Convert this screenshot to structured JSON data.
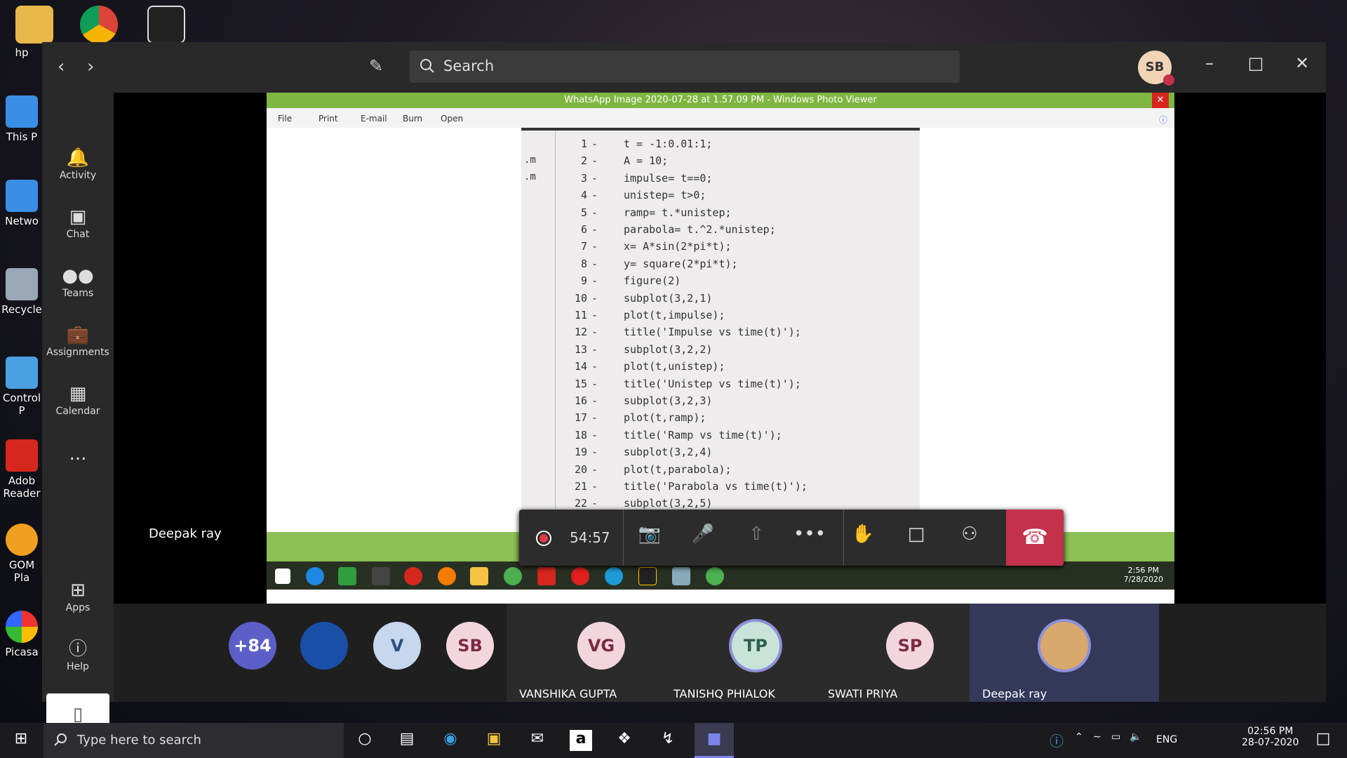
{
  "desktop": {
    "icons": [
      {
        "label": "hp"
      },
      {
        "label": "This P"
      },
      {
        "label": "Netwo"
      },
      {
        "label": "Recycle"
      },
      {
        "label": "Control P"
      },
      {
        "label": "Adob Reader"
      },
      {
        "label": "GOM Pla"
      },
      {
        "label": "Picasa"
      }
    ]
  },
  "teams": {
    "search_placeholder": "Search",
    "user_initials": "SB",
    "rail": [
      {
        "label": "Activity",
        "icon": "bell-icon"
      },
      {
        "label": "Chat",
        "icon": "chat-icon"
      },
      {
        "label": "Teams",
        "icon": "teams-icon"
      },
      {
        "label": "Assignments",
        "icon": "assignments-icon"
      },
      {
        "label": "Calendar",
        "icon": "calendar-icon"
      },
      {
        "label": "...",
        "icon": "more-icon"
      },
      {
        "label": "Apps",
        "icon": "apps-icon"
      },
      {
        "label": "Help",
        "icon": "help-icon"
      }
    ],
    "presenter_label": "Deepak ray",
    "call_timer": "54:57",
    "accent": "#c4314b"
  },
  "viewer": {
    "title": "WhatsApp Image 2020-07-28 at 1.57.09 PM - Windows Photo Viewer",
    "menu": [
      "File",
      "Print",
      "E-mail",
      "Burn",
      "Open"
    ],
    "side_labels": [
      ".m",
      ".m"
    ],
    "code_lines": [
      {
        "n": "1",
        "code": "t = -1:0.01:1;"
      },
      {
        "n": "2",
        "code": "A = 10;"
      },
      {
        "n": "3",
        "code": "impulse= t==0;"
      },
      {
        "n": "4",
        "code": "unistep= t>0;"
      },
      {
        "n": "5",
        "code": "ramp= t.*unistep;"
      },
      {
        "n": "6",
        "code": "parabola= t.^2.*unistep;"
      },
      {
        "n": "7",
        "code": "x= A*sin(2*pi*t);"
      },
      {
        "n": "8",
        "code": "y= square(2*pi*t);"
      },
      {
        "n": "9",
        "code": "figure(2)"
      },
      {
        "n": "10",
        "code": "subplot(3,2,1)"
      },
      {
        "n": "11",
        "code": "plot(t,impulse);"
      },
      {
        "n": "12",
        "code": "title('Impulse vs time(t)');"
      },
      {
        "n": "13",
        "code": "subplot(3,2,2)"
      },
      {
        "n": "14",
        "code": "plot(t,unistep);"
      },
      {
        "n": "15",
        "code": "title('Unistep vs time(t)');"
      },
      {
        "n": "16",
        "code": "subplot(3,2,3)"
      },
      {
        "n": "17",
        "code": "plot(t,ramp);"
      },
      {
        "n": "18",
        "code": "title('Ramp vs time(t)');"
      },
      {
        "n": "19",
        "code": "subplot(3,2,4)"
      },
      {
        "n": "20",
        "code": "plot(t,parabola);"
      },
      {
        "n": "21",
        "code": "title('Parabola vs time(t)');"
      },
      {
        "n": "22",
        "code": "subplot(3,2,5)"
      }
    ],
    "clock_time": "2:56 PM",
    "clock_date": "7/28/2020"
  },
  "participants": [
    {
      "initials": "+84",
      "name": "",
      "color": "#5b5fc7",
      "fg": "#ffffff"
    },
    {
      "initials": "",
      "name": "",
      "color": "#1a4fa8",
      "fg": "#ffffff"
    },
    {
      "initials": "V",
      "name": "",
      "color": "#c6d7ee",
      "fg": "#2f4f7f"
    },
    {
      "initials": "SB",
      "name": "",
      "color": "#f3d6dd",
      "fg": "#7b2b45"
    },
    {
      "initials": "VG",
      "name": "VANSHIKA GUPTA",
      "color": "#f3d6dd",
      "fg": "#7b2b45"
    },
    {
      "initials": "TP",
      "name": "TANISHQ PHIALOK",
      "color": "#c8e4d8",
      "fg": "#2f5f4f"
    },
    {
      "initials": "SP",
      "name": "SWATI PRIYA",
      "color": "#f3d6dd",
      "fg": "#7b2b45"
    },
    {
      "initials": "",
      "name": "Deepak ray",
      "color": "#d9a86c",
      "fg": "#ffffff"
    }
  ],
  "taskbar": {
    "search_placeholder": "Type here to search",
    "lang": "ENG",
    "time": "02:56 PM",
    "date": "28-07-2020"
  }
}
